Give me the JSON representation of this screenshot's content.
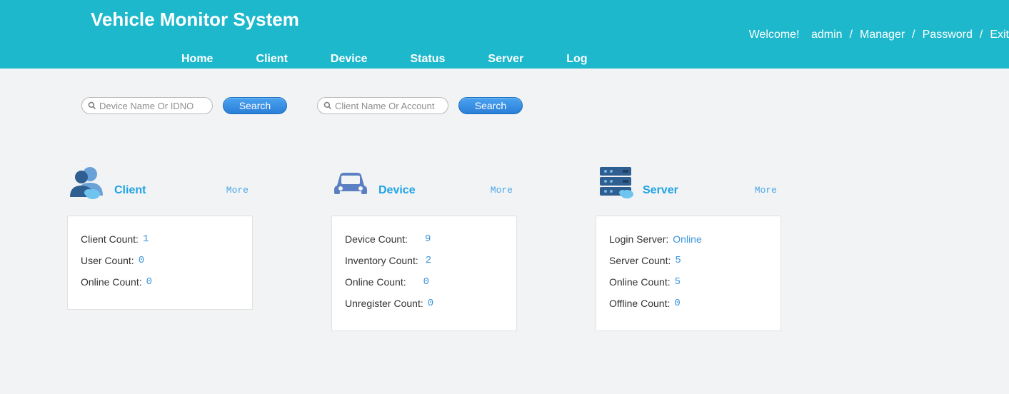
{
  "header": {
    "title": "Vehicle Monitor System",
    "welcome": "Welcome!",
    "user": "admin",
    "links": {
      "manager": "Manager",
      "password": "Password",
      "exit": "Exit"
    },
    "nav": [
      "Home",
      "Client",
      "Device",
      "Status",
      "Server",
      "Log"
    ]
  },
  "search": {
    "device_placeholder": "Device Name Or IDNO",
    "client_placeholder": "Client Name Or Account",
    "button": "Search"
  },
  "cards": {
    "client": {
      "title": "Client",
      "more": "More",
      "rows": [
        {
          "label": "Client Count:",
          "value": "1"
        },
        {
          "label": "User Count:",
          "value": "0"
        },
        {
          "label": "Online Count:",
          "value": "0"
        }
      ]
    },
    "device": {
      "title": "Device",
      "more": "More",
      "rows": [
        {
          "label": "Device Count:",
          "value": "9"
        },
        {
          "label": "Inventory Count:",
          "value": "2"
        },
        {
          "label": "Online Count:",
          "value": "0"
        },
        {
          "label": "Unregister Count:",
          "value": "0"
        }
      ]
    },
    "server": {
      "title": "Server",
      "more": "More",
      "rows": [
        {
          "label": "Login Server:",
          "value": "Online"
        },
        {
          "label": "Server Count:",
          "value": "5"
        },
        {
          "label": "Online Count:",
          "value": "5"
        },
        {
          "label": "Offline Count:",
          "value": "0"
        }
      ]
    }
  }
}
